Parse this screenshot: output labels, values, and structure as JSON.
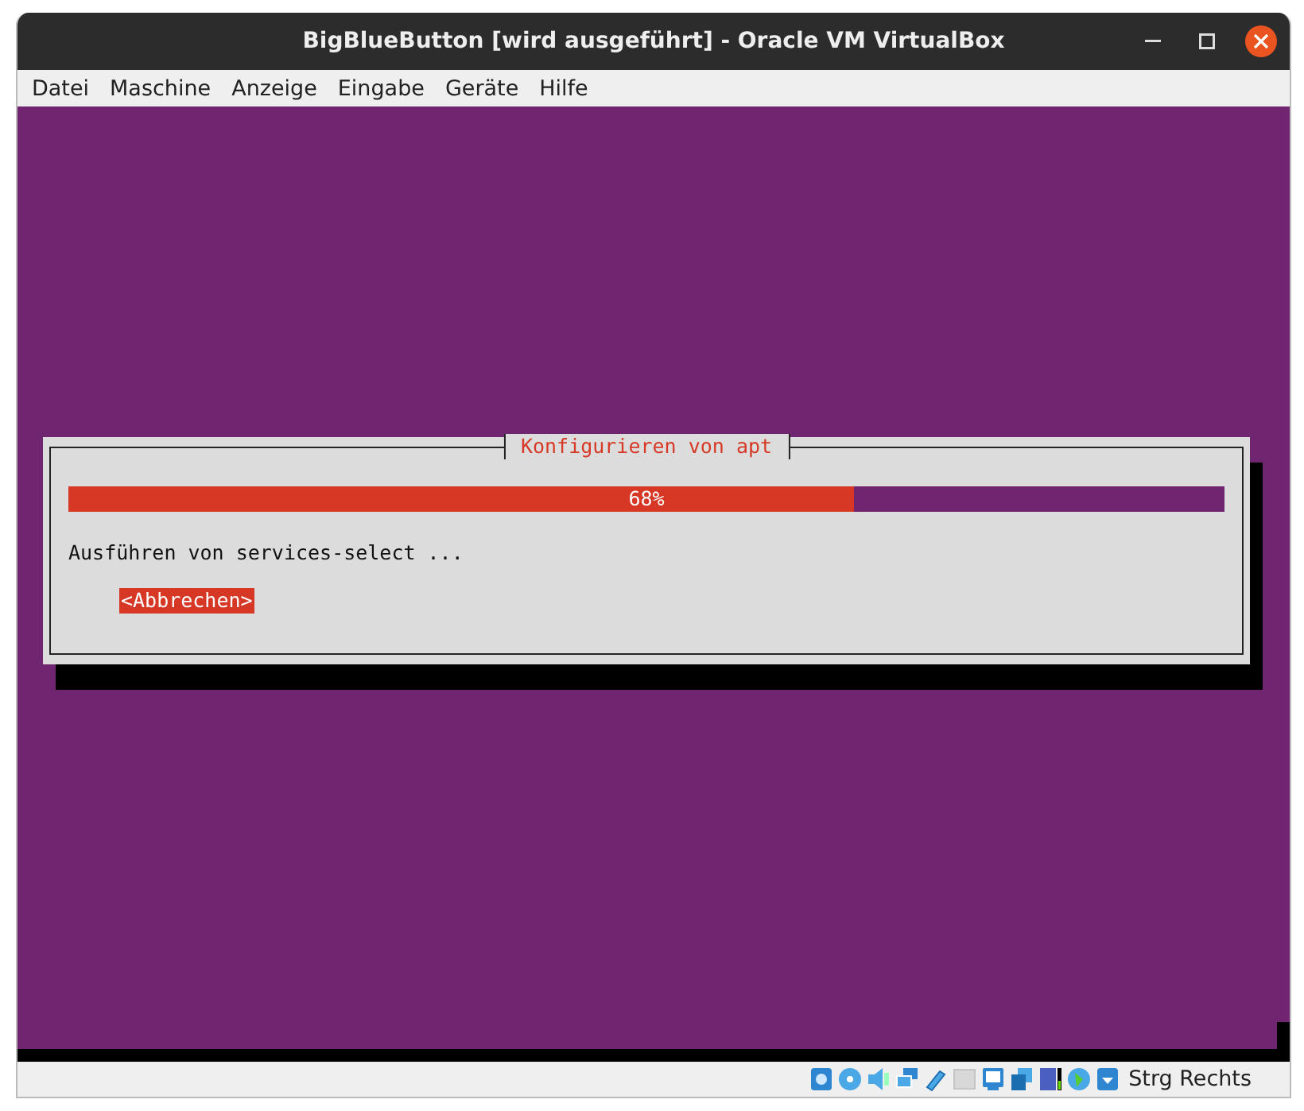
{
  "window": {
    "title": "BigBlueButton [wird ausgeführt] - Oracle VM VirtualBox"
  },
  "menu": [
    "Datei",
    "Maschine",
    "Anzeige",
    "Eingabe",
    "Geräte",
    "Hilfe"
  ],
  "dialog": {
    "title": "Konfigurieren von apt",
    "progress": {
      "level": 0.68,
      "label": "68%"
    },
    "message": "Ausführen von services-select ...",
    "button": {
      "label": "<Abbrechen>",
      "selected": true
    }
  },
  "status_bar": {
    "host_key": "Strg Rechts"
  }
}
